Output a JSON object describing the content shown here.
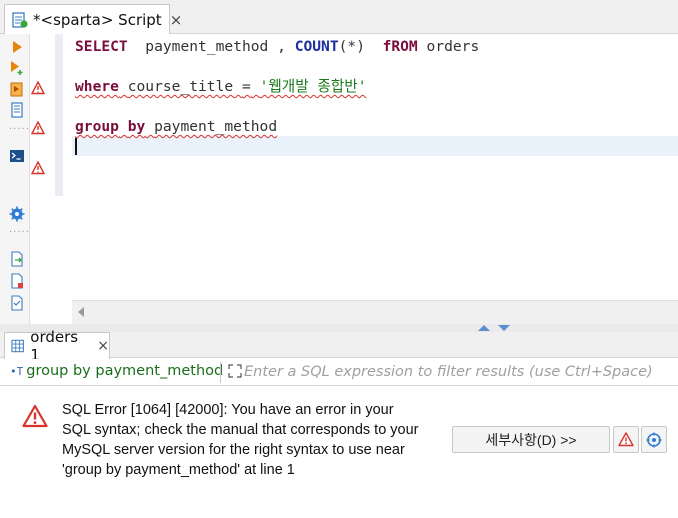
{
  "editor": {
    "tab_label": "*<sparta> Script",
    "tab_close": "×",
    "lines": {
      "l1": {
        "select": "SELECT",
        "col": "payment_method",
        "comma": ",",
        "count": "COUNT",
        "count_arg": "(*)",
        "from": "fROM",
        "table": "orders"
      },
      "l3": {
        "where": "where",
        "field": "course_title",
        "eq": "=",
        "value": "'웹개발 종합반'"
      },
      "l5": {
        "group": "group",
        "by": "by",
        "field": "payment_method"
      }
    }
  },
  "results": {
    "tab_label": "orders 1",
    "tab_close": "×",
    "filter": {
      "query_icon": "•T",
      "query_text": "group by payment_method",
      "placeholder": "Enter a SQL expression to filter results (use Ctrl+Space)"
    },
    "error": {
      "message": "SQL Error [1064] [42000]: You have an error in your\nSQL syntax; check the manual that corresponds to your\nMySQL server version for the right syntax to use near\n'group by payment_method' at line 1",
      "details_button": "세부사항(D) >>"
    }
  },
  "colors": {
    "keyword": "#7a0d3c",
    "function": "#1a2e9c",
    "string": "#1c7a1c",
    "error_red": "#d9342b",
    "current_line": "#e9f1fb"
  },
  "icons": [
    "script-tab-icon",
    "execute-statement-icon",
    "execute-script-icon",
    "explain-plan-icon",
    "history-icon",
    "console-icon",
    "settings-icon",
    "export-icon",
    "import-icon",
    "format-icon",
    "error-icon",
    "show-log-icon",
    "locate-icon"
  ]
}
